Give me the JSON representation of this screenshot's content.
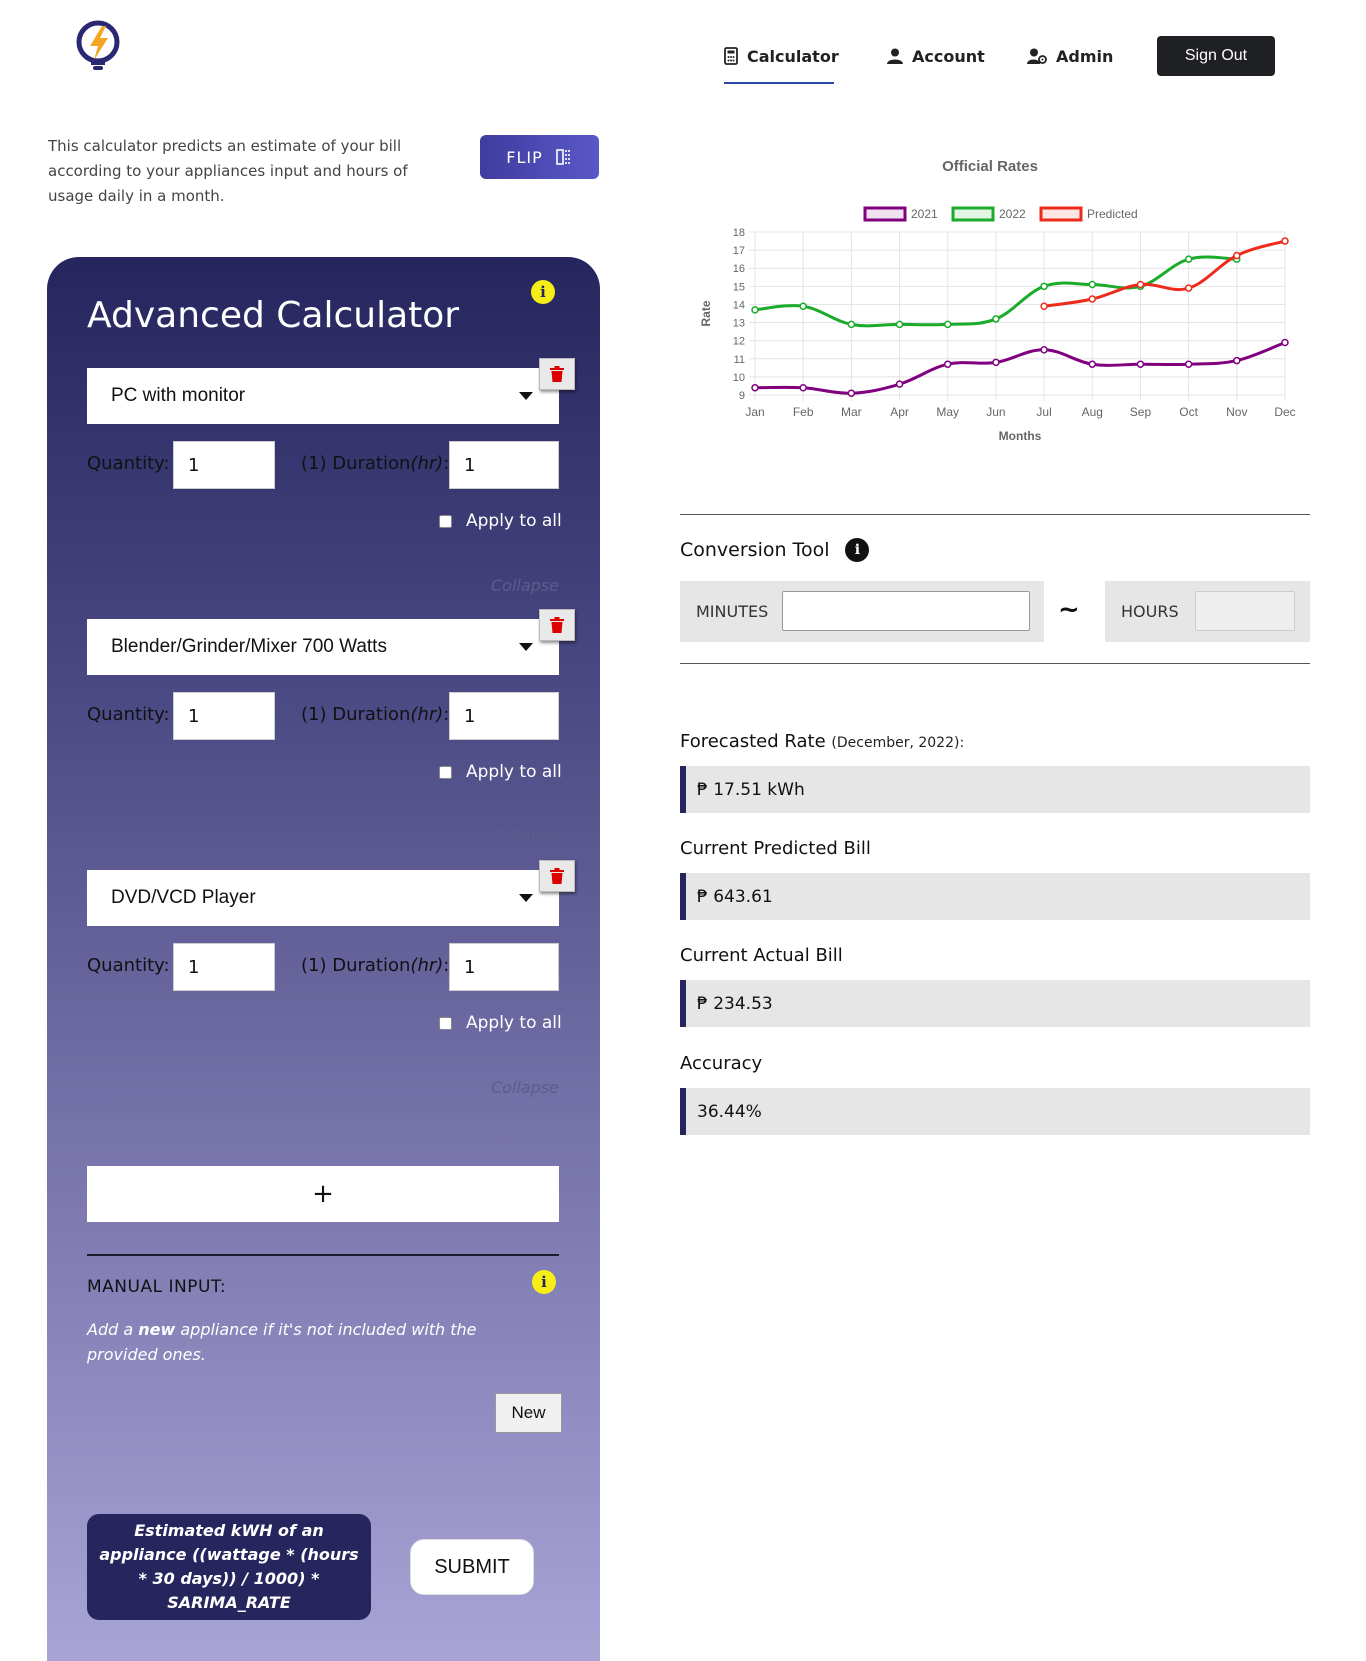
{
  "header": {
    "nav": [
      {
        "label": "Calculator",
        "icon": "calculator-icon",
        "active": true
      },
      {
        "label": "Account",
        "icon": "user-icon"
      },
      {
        "label": "Admin",
        "icon": "admin-user-icon"
      }
    ],
    "sign_out_label": "Sign Out"
  },
  "intro": {
    "text": "This calculator predicts an estimate of your bill according to your appliances input and hours of usage daily in a month.",
    "flip_label": "FLIP"
  },
  "calculator": {
    "title": "Advanced Calculator",
    "appliances": [
      {
        "name": "PC with monitor",
        "quantity": "1",
        "duration": "1",
        "index_label": "(1)"
      },
      {
        "name": "Blender/Grinder/Mixer 700 Watts",
        "quantity": "1",
        "duration": "1",
        "index_label": "(1)"
      },
      {
        "name": "DVD/VCD Player",
        "quantity": "1",
        "duration": "1",
        "index_label": "(1)"
      }
    ],
    "quantity_label": "Quantity:",
    "duration_label": "Duration",
    "duration_unit": "(hr)",
    "apply_all_label": "Apply to all",
    "collapse_label": "Collapse",
    "add_label": "+",
    "manual": {
      "title": "MANUAL INPUT:",
      "desc_pre": "Add a ",
      "desc_bold": "new",
      "desc_post": " appliance if it's not included with the provided ones.",
      "new_label": "New"
    },
    "formula_text": "Estimated kWH of an appliance ((wattage * (hours * 30 days)) / 1000) * SARIMA_RATE",
    "submit_label": "SUBMIT"
  },
  "chart_data": {
    "type": "line",
    "title": "Official Rates",
    "xlabel": "Months",
    "ylabel": "Rate",
    "categories": [
      "Jan",
      "Feb",
      "Mar",
      "Apr",
      "May",
      "Jun",
      "Jul",
      "Aug",
      "Sep",
      "Oct",
      "Nov",
      "Dec"
    ],
    "ylim": [
      9,
      18
    ],
    "yticks": [
      9,
      10,
      11,
      12,
      13,
      14,
      15,
      16,
      17,
      18
    ],
    "legend_position": "top",
    "series": [
      {
        "name": "2021",
        "color": "#800080",
        "values": [
          9.4,
          9.4,
          9.1,
          9.6,
          10.7,
          10.8,
          11.5,
          10.7,
          10.7,
          10.7,
          10.9,
          11.9
        ]
      },
      {
        "name": "2022",
        "color": "#1aab2b",
        "values": [
          13.7,
          13.9,
          12.9,
          12.9,
          12.9,
          13.2,
          15.0,
          15.1,
          15.0,
          16.5,
          16.5,
          null
        ]
      },
      {
        "name": "Predicted",
        "color": "#ee2a1b",
        "values": [
          null,
          null,
          null,
          null,
          null,
          null,
          13.9,
          14.3,
          15.1,
          14.9,
          16.7,
          17.5
        ]
      }
    ]
  },
  "conversion": {
    "title": "Conversion Tool",
    "minutes_label": "MINUTES",
    "minutes_value": "",
    "hours_label": "HOURS",
    "hours_value": "",
    "arrow": "~"
  },
  "results": {
    "forecast_label": "Forecasted Rate",
    "forecast_period": "(December, 2022):",
    "forecast_value": "₱ 17.51 kWh",
    "predicted_label": "Current Predicted Bill",
    "predicted_value": "₱ 643.61",
    "actual_label": "Current Actual Bill",
    "actual_value": "₱ 234.53",
    "accuracy_label": "Accuracy",
    "accuracy_value": "36.44%"
  }
}
